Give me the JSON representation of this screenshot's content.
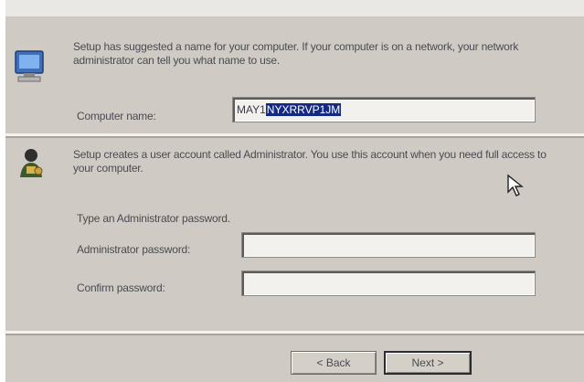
{
  "computer_section": {
    "description": "Setup has suggested a name for your computer.  If your computer is on a network, your network administrator can tell you what name to use.",
    "name_label": "Computer name:",
    "name_value_plain": "MAY1",
    "name_value_selected": "NYXRRVP1JM"
  },
  "admin_section": {
    "description": "Setup creates a user account called Administrator.  You use this account when you need full access to your computer.",
    "type_prompt": "Type an Administrator password.",
    "password_label": "Administrator password:",
    "confirm_label": "Confirm password:",
    "password_value": "",
    "confirm_value": ""
  },
  "buttons": {
    "back_label": "< Back",
    "next_label": "Next >"
  },
  "icons": {
    "computer": "network-computer-icon",
    "admin": "admin-user-icon",
    "cursor": "mouse-pointer"
  }
}
